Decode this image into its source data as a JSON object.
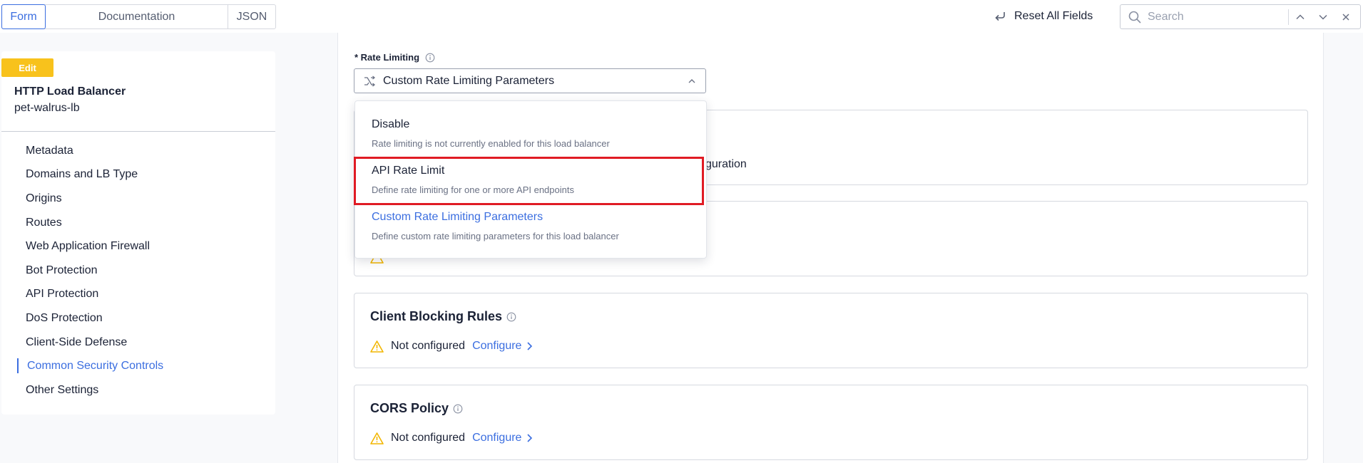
{
  "view_tabs": {
    "form": "Form",
    "documentation": "Documentation",
    "json": "JSON"
  },
  "toolbar": {
    "reset_label": "Reset All Fields",
    "search_placeholder": "Search"
  },
  "sidebar": {
    "edit_badge": "Edit",
    "object_type": "HTTP Load Balancer",
    "object_name": "pet-walrus-lb",
    "items": [
      {
        "label": "Metadata"
      },
      {
        "label": "Domains and LB Type"
      },
      {
        "label": "Origins"
      },
      {
        "label": "Routes"
      },
      {
        "label": "Web Application Firewall"
      },
      {
        "label": "Bot Protection"
      },
      {
        "label": "API Protection"
      },
      {
        "label": "DoS Protection"
      },
      {
        "label": "Client-Side Defense"
      },
      {
        "label": "Common Security Controls",
        "active": true
      },
      {
        "label": "Other Settings"
      }
    ]
  },
  "main": {
    "rate_limiting": {
      "label": "* Rate Limiting",
      "selected": "Custom Rate Limiting Parameters",
      "options": [
        {
          "label": "Disable",
          "description": "Rate limiting is not currently enabled for this load balancer"
        },
        {
          "label": "API Rate Limit",
          "description": "Define rate limiting for one or more API endpoints"
        },
        {
          "label": "Custom Rate Limiting Parameters",
          "description": "Define custom rate limiting parameters for this load balancer"
        }
      ]
    },
    "hidden_section_text": "guration",
    "sections": [
      {
        "title": "Client Blocking Rules",
        "status": "Not configured",
        "action": "Configure"
      },
      {
        "title": "CORS Policy",
        "status": "Not configured",
        "action": "Configure"
      }
    ]
  },
  "colors": {
    "accent": "#3b6ee0",
    "warning": "#f8c21c",
    "highlight": "#e01b24"
  },
  "icons": [
    "reset-icon",
    "search-icon",
    "chevron-up-icon",
    "chevron-down-icon",
    "close-icon",
    "info-icon",
    "branch-icon",
    "warning-icon",
    "chevron-right-icon"
  ]
}
